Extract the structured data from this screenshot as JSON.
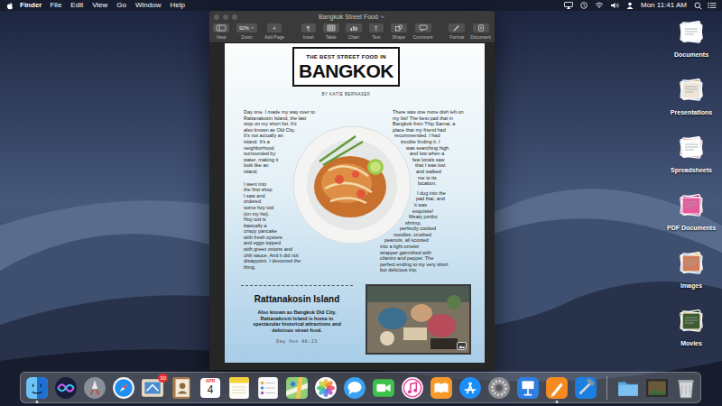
{
  "menu_bar": {
    "app": "Finder",
    "menus": [
      "File",
      "Edit",
      "View",
      "Go",
      "Window",
      "Help"
    ],
    "clock": "Mon 11:41 AM"
  },
  "window": {
    "title": "Bangkok Street Food",
    "toolbar": [
      {
        "label": "View",
        "kind": "view"
      },
      {
        "label": "Zoom",
        "kind": "zoom",
        "value": "92%"
      },
      {
        "label": "Add Page",
        "kind": "glyph",
        "glyph": "+"
      },
      {
        "label": "Insert",
        "kind": "glyph",
        "glyph": "¶"
      },
      {
        "label": "Table",
        "kind": "table"
      },
      {
        "label": "Chart",
        "kind": "chart"
      },
      {
        "label": "Text",
        "kind": "glyph",
        "glyph": "T"
      },
      {
        "label": "Shape",
        "kind": "shape"
      },
      {
        "label": "Comment",
        "kind": "comment"
      },
      {
        "label": "Format",
        "kind": "format"
      },
      {
        "label": "Document",
        "kind": "document"
      }
    ]
  },
  "document": {
    "kicker": "THE BEST STREET FOOD IN",
    "title": "BANGKOK",
    "byline": "BY KATIE BERNASEK",
    "left_column": [
      [
        "Day one. I made my way over to",
        "Rattanakosin Island, the last",
        "stop on my short list. It's",
        "also known as Old City.",
        "It's not actually an",
        "island. It's a",
        "neighborhood",
        "surrounded by",
        "water, making it",
        "look like an",
        "island."
      ],
      [
        "I went into",
        "the first shop",
        "I saw and",
        "ordered",
        "some hoy tod",
        "(on my list).",
        "Hoy tod is",
        "basically a",
        "crispy pancake",
        "with fresh oysters",
        "and eggs topped",
        "with green onions and",
        "chili sauce. And it did not",
        "disappoint. I devoured the",
        "thing."
      ]
    ],
    "right_column": [
      [
        "There was one more dish left on",
        "my list! The best pad thai in",
        "Bangkok from Thip Samai, a",
        "place that my friend had",
        "recommended. I had",
        "trouble finding it. I",
        "was searching high",
        "and low when a",
        "few locals saw",
        "that I was lost",
        "and walked",
        "me to its",
        "location."
      ],
      [
        "I dug into the",
        "pad thai, and",
        "it was",
        "exquisite!",
        "Meaty jumbo",
        "shrimp,",
        "perfectly cooked",
        "noodles, crushed",
        "peanuts, all scooted",
        "into a light omelet",
        "wrapper garnished with",
        "cilantro and pepper. The",
        "perfect ending to my very short",
        "but delicious trip."
      ]
    ],
    "section": {
      "heading": "Rattanakosin Island",
      "body": [
        "Also known as Bangkok Old City,",
        "Rattanakosin Island is home to",
        "spectacular historical attractions and",
        "delicious street food."
      ],
      "caption": "Day One 06:23"
    }
  },
  "desktop_stacks": [
    {
      "label": "Documents",
      "kind": "documents"
    },
    {
      "label": "Presentations",
      "kind": "presentations"
    },
    {
      "label": "Spreadsheets",
      "kind": "spreadsheets"
    },
    {
      "label": "PDF Documents",
      "kind": "pdf"
    },
    {
      "label": "Images",
      "kind": "images"
    },
    {
      "label": "Movies",
      "kind": "movies"
    }
  ],
  "dock": [
    {
      "kind": "finder",
      "running": true
    },
    {
      "kind": "siri",
      "running": false
    },
    {
      "kind": "launchpad",
      "running": false
    },
    {
      "kind": "safari",
      "running": false
    },
    {
      "kind": "mail",
      "running": false,
      "badge": "30"
    },
    {
      "kind": "contacts",
      "running": false
    },
    {
      "kind": "calendar",
      "running": false,
      "month": "APR",
      "day": "4"
    },
    {
      "kind": "notes",
      "running": false
    },
    {
      "kind": "reminders",
      "running": false
    },
    {
      "kind": "maps",
      "running": false
    },
    {
      "kind": "photos",
      "running": false
    },
    {
      "kind": "messages",
      "running": false
    },
    {
      "kind": "facetime",
      "running": false
    },
    {
      "kind": "itunes",
      "running": false
    },
    {
      "kind": "books",
      "running": false
    },
    {
      "kind": "appstore",
      "running": false
    },
    {
      "kind": "sysprefs",
      "running": false
    },
    {
      "kind": "keynote",
      "running": false
    },
    {
      "kind": "pages",
      "running": true
    },
    {
      "kind": "xcode",
      "running": false
    },
    {
      "kind": "folder",
      "running": false
    },
    {
      "kind": "recent",
      "running": false
    },
    {
      "kind": "trash",
      "running": false
    }
  ]
}
